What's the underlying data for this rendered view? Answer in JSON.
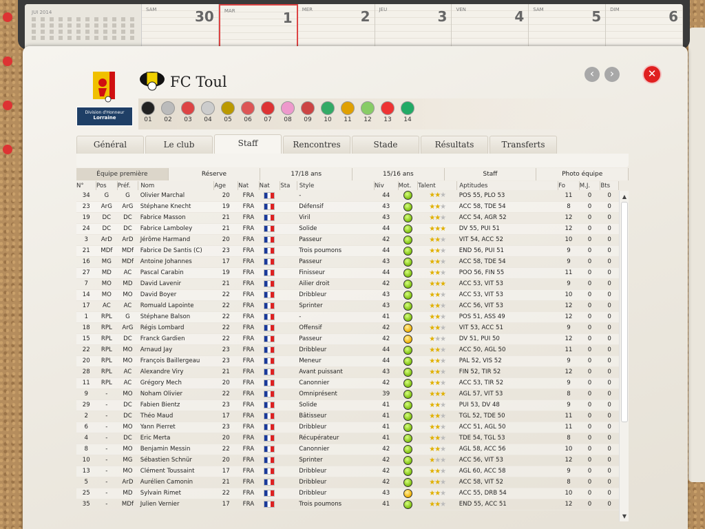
{
  "calendar": {
    "mini_title": "JUI 2014",
    "days": [
      {
        "name": "SAM",
        "num": "30"
      },
      {
        "name": "MAR",
        "num": "1"
      },
      {
        "name": "MER",
        "num": "2"
      },
      {
        "name": "JEU",
        "num": "3"
      },
      {
        "name": "VEN",
        "num": "4"
      },
      {
        "name": "SAM",
        "num": "5"
      },
      {
        "name": "DIM",
        "num": "6"
      }
    ]
  },
  "league": {
    "label_line1": "Division d'Honneur",
    "label_line2": "Lorraine"
  },
  "club": {
    "name": "FC Toul"
  },
  "teams": [
    "01",
    "02",
    "03",
    "04",
    "05",
    "06",
    "07",
    "08",
    "09",
    "10",
    "11",
    "12",
    "13",
    "14"
  ],
  "team_colors": [
    "#222",
    "#bbb",
    "#d44",
    "#ccc",
    "#b90",
    "#d55",
    "#d33",
    "#e9c",
    "#c44",
    "#3a6",
    "#e0a000",
    "#8c6",
    "#e33",
    "#2a6"
  ],
  "tabs": [
    "Général",
    "Le club",
    "Staff",
    "Rencontres",
    "Stade",
    "Résultats",
    "Transferts"
  ],
  "active_tab": 2,
  "subtabs": [
    "Équipe première",
    "Réserve",
    "17/18 ans",
    "15/16 ans",
    "Staff",
    "Photo équipe"
  ],
  "active_subtab": 0,
  "columns": [
    "N°",
    "Pos",
    "Préf.",
    "Nom",
    "Age",
    "Nat",
    "Nat",
    "Sta",
    "Style",
    "Niv",
    "Mot.",
    "Talent",
    "Aptitudes",
    "Fo",
    "M.J.",
    "Bts"
  ],
  "players": [
    {
      "n": "34",
      "pos": "G",
      "pref": "G",
      "nom": "Olivier Marchal",
      "age": "20",
      "nat": "FRA",
      "style": "-",
      "niv": "44",
      "mot": "green",
      "talent": 2,
      "apt": "POS 55, PLO 53",
      "fo": "11",
      "mj": "0",
      "bts": "0"
    },
    {
      "n": "23",
      "pos": "ArG",
      "pref": "ArG",
      "nom": "Stéphane Knecht",
      "age": "19",
      "nat": "FRA",
      "style": "Défensif",
      "niv": "43",
      "mot": "green",
      "talent": 2,
      "apt": "ACC 58, TDE 54",
      "fo": "8",
      "mj": "0",
      "bts": "0"
    },
    {
      "n": "19",
      "pos": "DC",
      "pref": "DC",
      "nom": "Fabrice Masson",
      "age": "21",
      "nat": "FRA",
      "style": "Viril",
      "niv": "43",
      "mot": "green",
      "talent": 2,
      "apt": "ACC 54, AGR 52",
      "fo": "12",
      "mj": "0",
      "bts": "0"
    },
    {
      "n": "24",
      "pos": "DC",
      "pref": "DC",
      "nom": "Fabrice Lamboley",
      "age": "21",
      "nat": "FRA",
      "style": "Solide",
      "niv": "44",
      "mot": "green",
      "talent": 3,
      "apt": "DV 55, PUI 51",
      "fo": "12",
      "mj": "0",
      "bts": "0"
    },
    {
      "n": "3",
      "pos": "ArD",
      "pref": "ArD",
      "nom": "Jérôme Harmand",
      "age": "20",
      "nat": "FRA",
      "style": "Passeur",
      "niv": "42",
      "mot": "green",
      "talent": 2,
      "apt": "VIT 54, ACC 52",
      "fo": "10",
      "mj": "0",
      "bts": "0"
    },
    {
      "n": "21",
      "pos": "MDf",
      "pref": "MDf",
      "nom": "Fabrice De Santis (C)",
      "age": "23",
      "nat": "FRA",
      "style": "Trois poumons",
      "niv": "44",
      "mot": "green",
      "talent": 2,
      "apt": "END 56, PUI 51",
      "fo": "9",
      "mj": "0",
      "bts": "0"
    },
    {
      "n": "16",
      "pos": "MG",
      "pref": "MDf",
      "nom": "Antoine Johannes",
      "age": "17",
      "nat": "FRA",
      "style": "Passeur",
      "niv": "43",
      "mot": "green",
      "talent": 2,
      "apt": "ACC 58, TDE 54",
      "fo": "9",
      "mj": "0",
      "bts": "0"
    },
    {
      "n": "27",
      "pos": "MD",
      "pref": "AC",
      "nom": "Pascal Carabin",
      "age": "19",
      "nat": "FRA",
      "style": "Finisseur",
      "niv": "44",
      "mot": "green",
      "talent": 2,
      "apt": "POO 56, FIN 55",
      "fo": "11",
      "mj": "0",
      "bts": "0"
    },
    {
      "n": "7",
      "pos": "MO",
      "pref": "MD",
      "nom": "David Lavenir",
      "age": "21",
      "nat": "FRA",
      "style": "Ailier droit",
      "niv": "42",
      "mot": "green",
      "talent": 3,
      "apt": "ACC 53, VIT 53",
      "fo": "9",
      "mj": "0",
      "bts": "0"
    },
    {
      "n": "14",
      "pos": "MO",
      "pref": "MO",
      "nom": "David Boyer",
      "age": "22",
      "nat": "FRA",
      "style": "Dribbleur",
      "niv": "43",
      "mot": "green",
      "talent": 2,
      "apt": "ACC 53, VIT 53",
      "fo": "10",
      "mj": "0",
      "bts": "0"
    },
    {
      "n": "17",
      "pos": "AC",
      "pref": "AC",
      "nom": "Romuald Lapointe",
      "age": "22",
      "nat": "FRA",
      "style": "Sprinter",
      "niv": "43",
      "mot": "green",
      "talent": 2,
      "apt": "ACC 56, VIT 53",
      "fo": "12",
      "mj": "0",
      "bts": "0"
    },
    {
      "n": "1",
      "pos": "RPL",
      "pref": "G",
      "nom": "Stéphane Balson",
      "age": "22",
      "nat": "FRA",
      "style": "-",
      "niv": "41",
      "mot": "green",
      "talent": 2,
      "apt": "POS 51, ASS 49",
      "fo": "12",
      "mj": "0",
      "bts": "0"
    },
    {
      "n": "18",
      "pos": "RPL",
      "pref": "ArG",
      "nom": "Régis Lombard",
      "age": "22",
      "nat": "FRA",
      "style": "Offensif",
      "niv": "42",
      "mot": "yellow",
      "talent": 2,
      "apt": "VIT 53, ACC 51",
      "fo": "9",
      "mj": "0",
      "bts": "0"
    },
    {
      "n": "15",
      "pos": "RPL",
      "pref": "DC",
      "nom": "Franck Gardien",
      "age": "22",
      "nat": "FRA",
      "style": "Passeur",
      "niv": "42",
      "mot": "yellow",
      "talent": 1,
      "apt": "DV 51, PUI 50",
      "fo": "12",
      "mj": "0",
      "bts": "0"
    },
    {
      "n": "22",
      "pos": "RPL",
      "pref": "MO",
      "nom": "Arnaud Jay",
      "age": "23",
      "nat": "FRA",
      "style": "Dribbleur",
      "niv": "44",
      "mot": "green",
      "talent": 2,
      "apt": "ACC 50, AGL 50",
      "fo": "11",
      "mj": "0",
      "bts": "0"
    },
    {
      "n": "20",
      "pos": "RPL",
      "pref": "MO",
      "nom": "François Baillergeau",
      "age": "23",
      "nat": "FRA",
      "style": "Meneur",
      "niv": "44",
      "mot": "green",
      "talent": 2,
      "apt": "PAL 52, VIS 52",
      "fo": "9",
      "mj": "0",
      "bts": "0"
    },
    {
      "n": "28",
      "pos": "RPL",
      "pref": "AC",
      "nom": "Alexandre Viry",
      "age": "21",
      "nat": "FRA",
      "style": "Avant puissant",
      "niv": "43",
      "mot": "green",
      "talent": 2,
      "apt": "FIN 52, TIR 52",
      "fo": "12",
      "mj": "0",
      "bts": "0"
    },
    {
      "n": "11",
      "pos": "RPL",
      "pref": "AC",
      "nom": "Grégory Mech",
      "age": "20",
      "nat": "FRA",
      "style": "Canonnier",
      "niv": "42",
      "mot": "green",
      "talent": 2,
      "apt": "ACC 53, TIR 52",
      "fo": "9",
      "mj": "0",
      "bts": "0"
    },
    {
      "n": "9",
      "pos": "-",
      "pref": "MO",
      "nom": "Noham Olivier",
      "age": "22",
      "nat": "FRA",
      "style": "Omniprésent",
      "niv": "39",
      "mot": "green",
      "talent": 3,
      "apt": "AGL 57, VIT 53",
      "fo": "8",
      "mj": "0",
      "bts": "0"
    },
    {
      "n": "29",
      "pos": "-",
      "pref": "DC",
      "nom": "Fabien Bientz",
      "age": "23",
      "nat": "FRA",
      "style": "Solide",
      "niv": "41",
      "mot": "green",
      "talent": 2,
      "apt": "PUI 53, DV 48",
      "fo": "9",
      "mj": "0",
      "bts": "0"
    },
    {
      "n": "2",
      "pos": "-",
      "pref": "DC",
      "nom": "Théo Maud",
      "age": "17",
      "nat": "FRA",
      "style": "Bâtisseur",
      "niv": "41",
      "mot": "green",
      "talent": 2,
      "apt": "TGL 52, TDE 50",
      "fo": "11",
      "mj": "0",
      "bts": "0"
    },
    {
      "n": "6",
      "pos": "-",
      "pref": "MO",
      "nom": "Yann Pierret",
      "age": "23",
      "nat": "FRA",
      "style": "Dribbleur",
      "niv": "41",
      "mot": "green",
      "talent": 2,
      "apt": "ACC 51, AGL 50",
      "fo": "11",
      "mj": "0",
      "bts": "0"
    },
    {
      "n": "4",
      "pos": "-",
      "pref": "DC",
      "nom": "Eric Merta",
      "age": "20",
      "nat": "FRA",
      "style": "Récupérateur",
      "niv": "41",
      "mot": "green",
      "talent": 2,
      "apt": "TDE 54, TGL 53",
      "fo": "8",
      "mj": "0",
      "bts": "0"
    },
    {
      "n": "8",
      "pos": "-",
      "pref": "MO",
      "nom": "Benjamin Messin",
      "age": "22",
      "nat": "FRA",
      "style": "Canonnier",
      "niv": "42",
      "mot": "green",
      "talent": 2,
      "apt": "AGL 58, ACC 56",
      "fo": "10",
      "mj": "0",
      "bts": "0"
    },
    {
      "n": "10",
      "pos": "-",
      "pref": "MG",
      "nom": "Sébastien Schnür",
      "age": "20",
      "nat": "FRA",
      "style": "Sprinter",
      "niv": "42",
      "mot": "green",
      "talent": 1,
      "apt": "ACC 56, VIT 53",
      "fo": "12",
      "mj": "0",
      "bts": "0"
    },
    {
      "n": "13",
      "pos": "-",
      "pref": "MO",
      "nom": "Clément Toussaint",
      "age": "17",
      "nat": "FRA",
      "style": "Dribbleur",
      "niv": "42",
      "mot": "green",
      "talent": 2,
      "apt": "AGL 60, ACC 58",
      "fo": "9",
      "mj": "0",
      "bts": "0"
    },
    {
      "n": "5",
      "pos": "-",
      "pref": "ArD",
      "nom": "Aurélien Camonin",
      "age": "21",
      "nat": "FRA",
      "style": "Dribbleur",
      "niv": "42",
      "mot": "green",
      "talent": 2,
      "apt": "ACC 58, VIT 52",
      "fo": "8",
      "mj": "0",
      "bts": "0"
    },
    {
      "n": "25",
      "pos": "-",
      "pref": "MD",
      "nom": "Sylvain Rimet",
      "age": "22",
      "nat": "FRA",
      "style": "Dribbleur",
      "niv": "43",
      "mot": "yellow",
      "talent": 2,
      "apt": "ACC 55, DRB 54",
      "fo": "10",
      "mj": "0",
      "bts": "0"
    },
    {
      "n": "35",
      "pos": "-",
      "pref": "MDf",
      "nom": "Julien Vernier",
      "age": "17",
      "nat": "FRA",
      "style": "Trois poumons",
      "niv": "41",
      "mot": "green",
      "talent": 2,
      "apt": "END 55, ACC 51",
      "fo": "12",
      "mj": "0",
      "bts": "0"
    }
  ]
}
